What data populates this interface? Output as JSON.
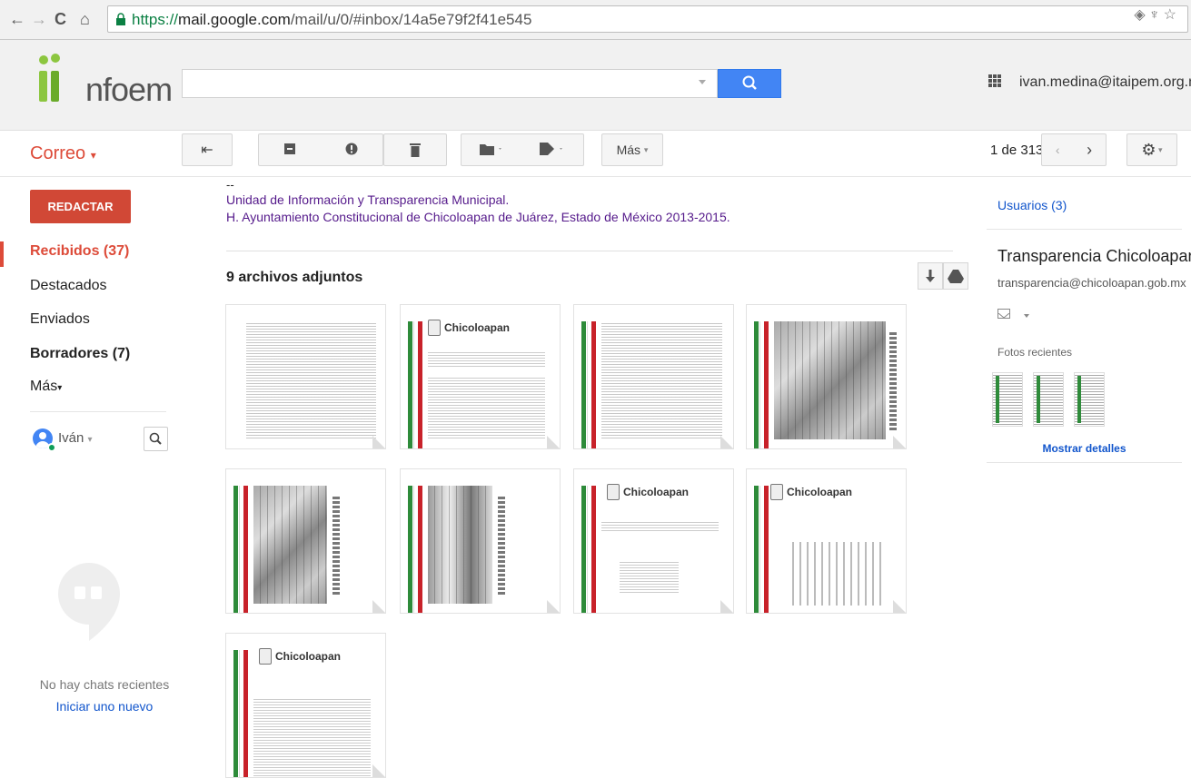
{
  "browser": {
    "url_prefix": "https://",
    "url_domain": "mail.google.com",
    "url_rest": "/mail/u/0/#inbox/14a5e79f2f41e545"
  },
  "header": {
    "logo_text": "nfoem",
    "search_placeholder": "",
    "account": "ivan.medina@itaipem.org.mx"
  },
  "toolbar": {
    "app_label": "Correo",
    "more_label": "Más",
    "pager_text": "1 de 313"
  },
  "sidebar": {
    "compose_label": "REDACTAR",
    "items": [
      {
        "label": "Recibidos (37)",
        "active": true
      },
      {
        "label": "Destacados"
      },
      {
        "label": "Enviados"
      },
      {
        "label": "Borradores (7)",
        "bold": true
      },
      {
        "label": "Más"
      }
    ],
    "chat_user": "Iván",
    "no_chats": "No hay chats recientes",
    "start_new": "Iniciar uno nuevo"
  },
  "message": {
    "dash": "--",
    "signature_line1": "Unidad de Información y Transparencia Municipal.",
    "signature_line2": "H. Ayuntamiento Constitucional de Chicoloapan de Juárez, Estado de México 2013-2015.",
    "attachments_title": "9 archivos adjuntos",
    "thumb_brand": "Chicoloapan"
  },
  "right_panel": {
    "users_label": "Usuarios (3)",
    "contact_name": "Transparencia Chicoloapan",
    "contact_email": "transparencia@chicoloapan.gob.mx",
    "recent_photos": "Fotos recientes",
    "show_details": "Mostrar detalles"
  },
  "colors": {
    "accent_red": "#dd4b39",
    "compose_red": "#d14836",
    "search_blue": "#4285f4",
    "link_blue": "#1155cc",
    "signature_purple": "#551a8b"
  }
}
